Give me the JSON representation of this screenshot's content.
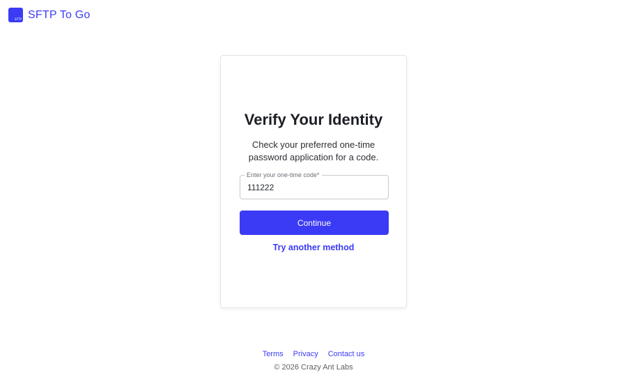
{
  "header": {
    "logo_text": "SFTP",
    "brand": "SFTP To Go"
  },
  "card": {
    "title": "Verify Your Identity",
    "subtitle": "Check your preferred one-time password application for a code.",
    "field": {
      "label": "Enter your one-time code*",
      "value": "111222"
    },
    "continue_label": "Continue",
    "try_another_label": "Try another method"
  },
  "footer": {
    "links": [
      "Terms",
      "Privacy",
      "Contact us"
    ],
    "copyright": "© 2026 Crazy Ant Labs"
  },
  "colors": {
    "accent": "#3b3bf5",
    "text": "#1c1f24",
    "border": "#c7cad0"
  }
}
